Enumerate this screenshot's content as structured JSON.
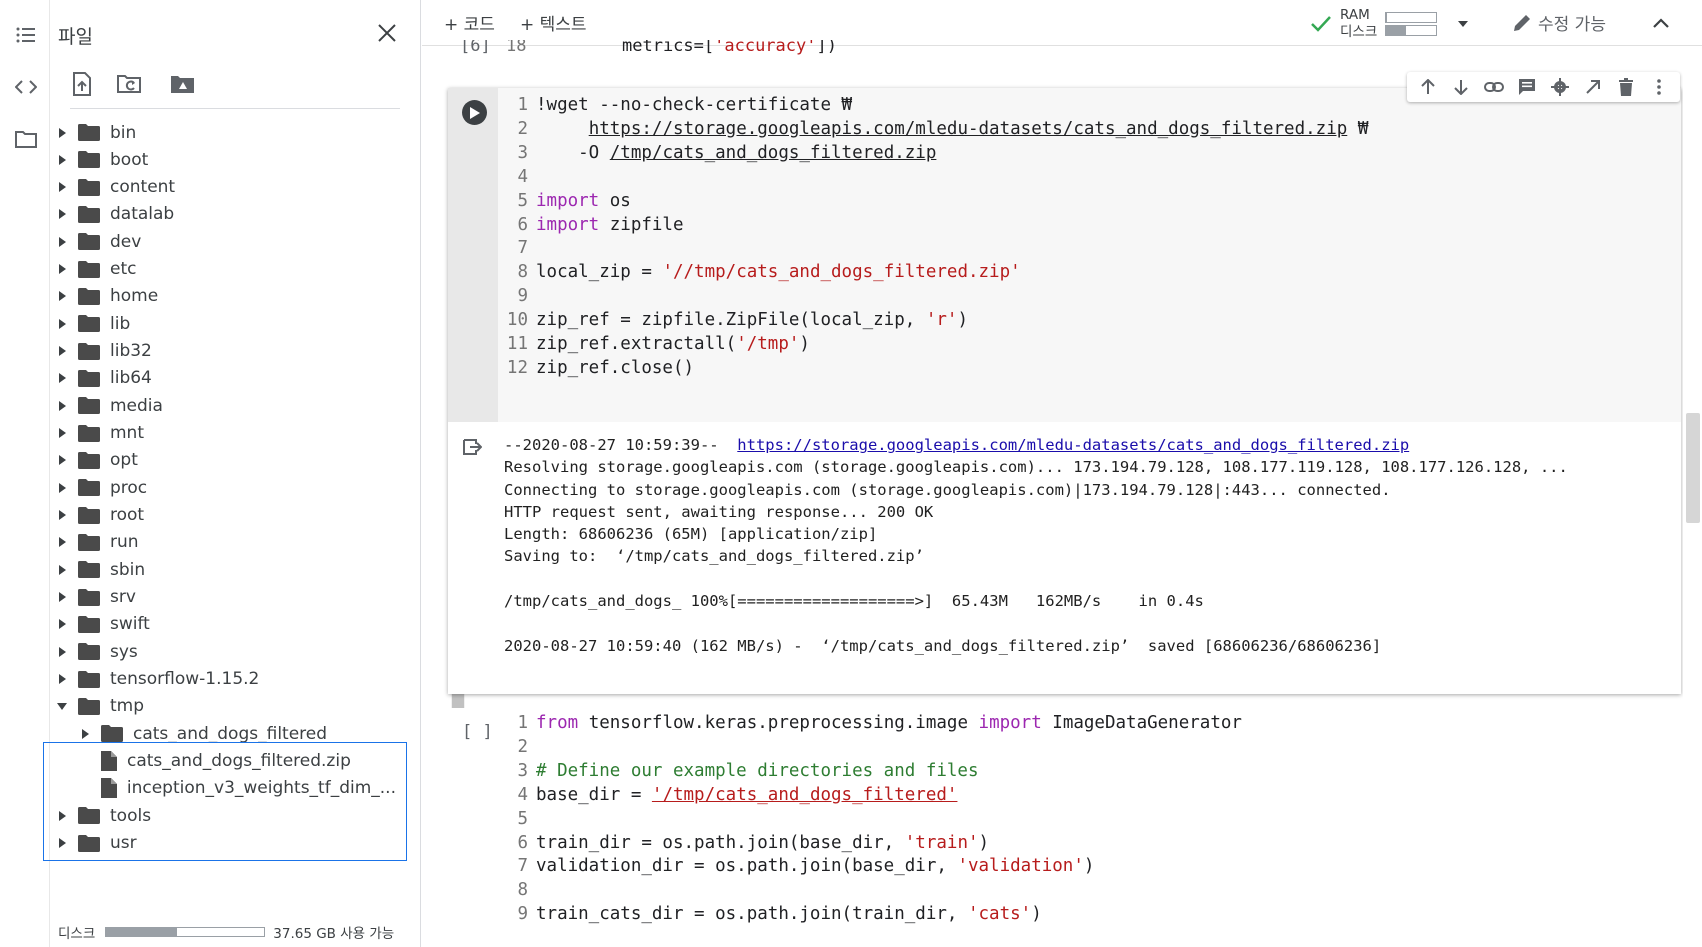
{
  "sidebar_panel": {
    "title": "파일",
    "tree": [
      {
        "name": "bin"
      },
      {
        "name": "boot"
      },
      {
        "name": "content"
      },
      {
        "name": "datalab"
      },
      {
        "name": "dev"
      },
      {
        "name": "etc"
      },
      {
        "name": "home"
      },
      {
        "name": "lib"
      },
      {
        "name": "lib32"
      },
      {
        "name": "lib64"
      },
      {
        "name": "media"
      },
      {
        "name": "mnt"
      },
      {
        "name": "opt"
      },
      {
        "name": "proc"
      },
      {
        "name": "root"
      },
      {
        "name": "run"
      },
      {
        "name": "sbin"
      },
      {
        "name": "srv"
      },
      {
        "name": "swift"
      },
      {
        "name": "sys"
      },
      {
        "name": "tensorflow-1.15.2"
      },
      {
        "name": "tmp"
      },
      {
        "name": "cats_and_dogs_filtered"
      },
      {
        "name": "cats_and_dogs_filtered.zip"
      },
      {
        "name": "inception_v3_weights_tf_dim_..."
      },
      {
        "name": "tools"
      },
      {
        "name": "usr"
      }
    ],
    "disk_label": "디스크",
    "disk_free": "37.65 GB 사용 가능",
    "disk_used_fraction": 0.45
  },
  "toolbar": {
    "add_code": "+ 코드",
    "add_text": "+ 텍스트",
    "ram_label": "RAM",
    "disk_label": "디스크",
    "ram_fraction": 0.02,
    "disk_fraction": 0.4,
    "edit_status": "수정 가능"
  },
  "prev_cell_fragment": {
    "bracket": "[6]",
    "line_no": "18",
    "text_pre": "metrics=[",
    "text_str": "'accuracy'",
    "text_post": "])"
  },
  "cell1": {
    "lines": [
      {
        "n": "1",
        "parts": [
          {
            "t": "!wget --no-check-certificate ₩",
            "c": ""
          }
        ]
      },
      {
        "n": "2",
        "parts": [
          {
            "t": "     ",
            "c": ""
          },
          {
            "t": "https://storage.googleapis.com/mledu-datasets/cats_and_dogs_filtered.zip",
            "c": "ul"
          },
          {
            "t": " ₩",
            "c": ""
          }
        ]
      },
      {
        "n": "3",
        "parts": [
          {
            "t": "    -O ",
            "c": ""
          },
          {
            "t": "/tmp/cats_and_dogs_filtered.zip",
            "c": "ul"
          }
        ]
      },
      {
        "n": "4",
        "parts": []
      },
      {
        "n": "5",
        "parts": [
          {
            "t": "import",
            "c": "kw"
          },
          {
            "t": " os",
            "c": ""
          }
        ]
      },
      {
        "n": "6",
        "parts": [
          {
            "t": "import",
            "c": "kw"
          },
          {
            "t": " zipfile",
            "c": ""
          }
        ]
      },
      {
        "n": "7",
        "parts": []
      },
      {
        "n": "8",
        "parts": [
          {
            "t": "local_zip = ",
            "c": ""
          },
          {
            "t": "'//tmp/cats_and_dogs_filtered.zip'",
            "c": "str"
          }
        ]
      },
      {
        "n": "9",
        "parts": []
      },
      {
        "n": "10",
        "parts": [
          {
            "t": "zip_ref = zipfile.ZipFile(local_zip, ",
            "c": ""
          },
          {
            "t": "'r'",
            "c": "str"
          },
          {
            "t": ")",
            "c": ""
          }
        ]
      },
      {
        "n": "11",
        "parts": [
          {
            "t": "zip_ref.extractall(",
            "c": ""
          },
          {
            "t": "'/tmp'",
            "c": "str"
          },
          {
            "t": ")",
            "c": ""
          }
        ]
      },
      {
        "n": "12",
        "parts": [
          {
            "t": "zip_ref.close()",
            "c": ""
          }
        ]
      }
    ],
    "output": {
      "line1_pre": "--2020-08-27 10:59:39--  ",
      "line1_link": "https://storage.googleapis.com/mledu-datasets/cats_and_dogs_filtered.zip",
      "rest": "Resolving storage.googleapis.com (storage.googleapis.com)... 173.194.79.128, 108.177.119.128, 108.177.126.128, ...\nConnecting to storage.googleapis.com (storage.googleapis.com)|173.194.79.128|:443... connected.\nHTTP request sent, awaiting response... 200 OK\nLength: 68606236 (65M) [application/zip]\nSaving to:  ‘/tmp/cats_and_dogs_filtered.zip’\n\n/tmp/cats_and_dogs_ 100%[===================>]  65.43M   162MB/s    in 0.4s\n\n2020-08-27 10:59:40 (162 MB/s) -  ‘/tmp/cats_and_dogs_filtered.zip’  saved [68606236/68606236]"
    }
  },
  "cell2": {
    "bracket": "[ ]",
    "lines": [
      {
        "n": "1",
        "parts": [
          {
            "t": "from",
            "c": "kw"
          },
          {
            "t": " tensorflow.keras.preprocessing.image ",
            "c": ""
          },
          {
            "t": "import",
            "c": "kw"
          },
          {
            "t": " ImageDataGenerator",
            "c": ""
          }
        ]
      },
      {
        "n": "2",
        "parts": []
      },
      {
        "n": "3",
        "parts": [
          {
            "t": "# Define our example directories and files",
            "c": "cm"
          }
        ]
      },
      {
        "n": "4",
        "parts": [
          {
            "t": "base_dir = ",
            "c": ""
          },
          {
            "t": "'/tmp/cats_and_dogs_filtered'",
            "c": "str ul"
          }
        ]
      },
      {
        "n": "5",
        "parts": []
      },
      {
        "n": "6",
        "parts": [
          {
            "t": "train_dir = os.path.join(base_dir, ",
            "c": ""
          },
          {
            "t": "'train'",
            "c": "str"
          },
          {
            "t": ")",
            "c": ""
          }
        ]
      },
      {
        "n": "7",
        "parts": [
          {
            "t": "validation_dir = os.path.join(base_dir, ",
            "c": ""
          },
          {
            "t": "'validation'",
            "c": "str"
          },
          {
            "t": ")",
            "c": ""
          }
        ]
      },
      {
        "n": "8",
        "parts": []
      },
      {
        "n": "9",
        "parts": [
          {
            "t": "train_cats_dir = os.path.join(train_dir, ",
            "c": ""
          },
          {
            "t": "'cats'",
            "c": "str"
          },
          {
            "t": ")",
            "c": ""
          }
        ]
      }
    ]
  },
  "icons": {
    "rail": [
      "toc-icon",
      "code-snippets-icon",
      "files-icon"
    ],
    "file_tools": [
      "upload-icon",
      "refresh-icon",
      "mount-drive-icon"
    ],
    "cell_tools": [
      "move-up-icon",
      "move-down-icon",
      "link-icon",
      "comment-icon",
      "settings-icon",
      "open-tab-icon",
      "delete-icon",
      "more-icon"
    ]
  }
}
